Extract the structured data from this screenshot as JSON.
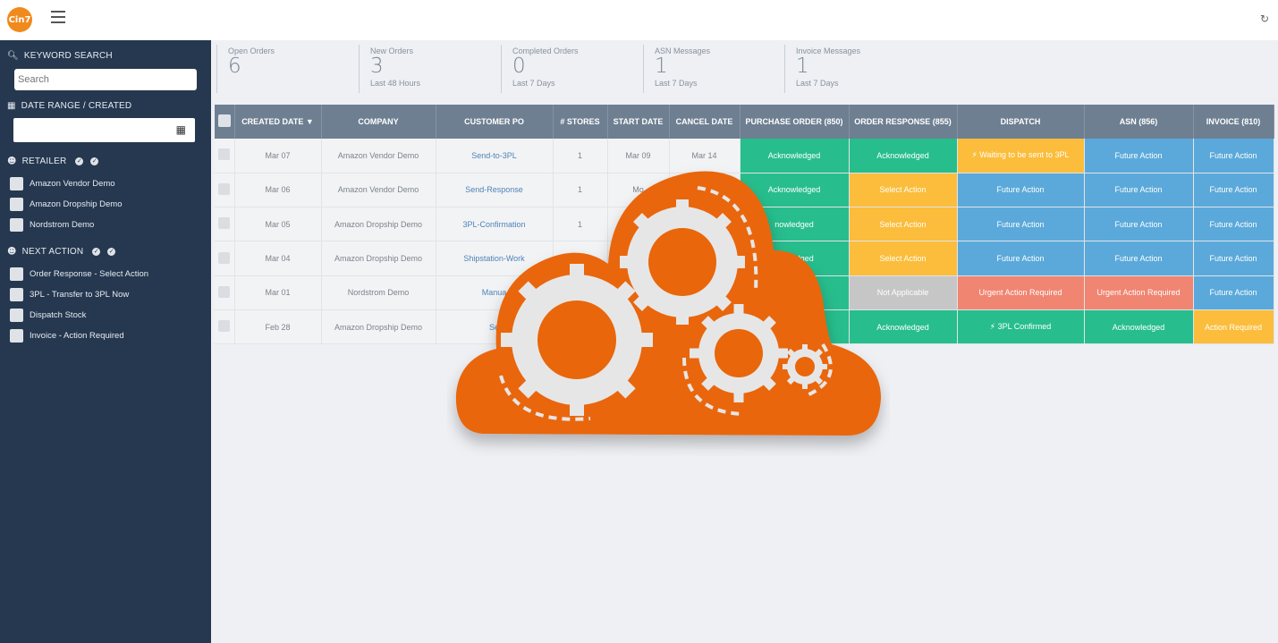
{
  "app": {
    "logo_text": "Cin7"
  },
  "icons": {
    "menu": "hamburger-icon",
    "refresh": "refresh-icon",
    "search": "search-icon",
    "calendar": "calendar-icon",
    "users": "users-icon",
    "check": "check-circle-icon",
    "bolt": "bolt-icon"
  },
  "sidebar": {
    "keyword_search": {
      "label": "KEYWORD SEARCH",
      "placeholder": "Search"
    },
    "date_range": {
      "label": "DATE RANGE / CREATED"
    },
    "retailer": {
      "label": "RETAILER",
      "items": [
        "Amazon Vendor Demo",
        "Amazon Dropship Demo",
        "Nordstrom Demo"
      ]
    },
    "next_action": {
      "label": "NEXT ACTION",
      "items": [
        "Order Response - Select Action",
        "3PL - Transfer to 3PL Now",
        "Dispatch Stock",
        "Invoice - Action Required"
      ]
    }
  },
  "stats": [
    {
      "label": "Open Orders",
      "value": "6",
      "sub": ""
    },
    {
      "label": "New Orders",
      "value": "3",
      "sub": "Last 48 Hours"
    },
    {
      "label": "Completed Orders",
      "value": "0",
      "sub": "Last 7 Days"
    },
    {
      "label": "ASN Messages",
      "value": "1",
      "sub": "Last 7 Days"
    },
    {
      "label": "Invoice Messages",
      "value": "1",
      "sub": "Last 7 Days"
    }
  ],
  "table": {
    "headers": [
      "CREATED DATE",
      "COMPANY",
      "CUSTOMER PO",
      "# STORES",
      "START DATE",
      "CANCEL DATE",
      "PURCHASE ORDER (850)",
      "ORDER RESPONSE (855)",
      "DISPATCH",
      "ASN (856)",
      "INVOICE (810)"
    ],
    "sort_indicator": "▼",
    "rows": [
      {
        "created": "Mar 07",
        "company": "Amazon Vendor Demo",
        "po": "Send-to-3PL",
        "stores": "1",
        "start": "Mar 09",
        "cancel": "Mar 14",
        "po850": "Acknowledged",
        "resp855": "Acknowledged",
        "dispatch": "Waiting to be sent to 3PL",
        "asn": "Future Action",
        "invoice": "Future Action"
      },
      {
        "created": "Mar 06",
        "company": "Amazon Vendor Demo",
        "po": "Send-Response",
        "stores": "1",
        "start": "Mo",
        "cancel": "",
        "po850": "Acknowledged",
        "resp855": "Select Action",
        "dispatch": "Future Action",
        "asn": "Future Action",
        "invoice": "Future Action"
      },
      {
        "created": "Mar 05",
        "company": "Amazon Dropship Demo",
        "po": "3PL-Confirmation",
        "stores": "1",
        "start": "",
        "cancel": "",
        "po850": "nowledged",
        "resp855": "Select Action",
        "dispatch": "Future Action",
        "asn": "Future Action",
        "invoice": "Future Action"
      },
      {
        "created": "Mar 04",
        "company": "Amazon Dropship Demo",
        "po": "Shipstation-Work",
        "stores": "",
        "start": "",
        "cancel": "",
        "po850": "nowledged",
        "resp855": "Select Action",
        "dispatch": "Future Action",
        "asn": "Future Action",
        "invoice": "Future Action"
      },
      {
        "created": "Mar 01",
        "company": "Nordstrom Demo",
        "po": "Manua",
        "stores": "",
        "start": "",
        "cancel": "",
        "po850": "",
        "resp855": "Not Applicable",
        "dispatch": "Urgent Action Required",
        "asn": "Urgent Action Required",
        "invoice": "Future Action"
      },
      {
        "created": "Feb 28",
        "company": "Amazon Dropship Demo",
        "po": "Se",
        "stores": "",
        "start": "",
        "cancel": "",
        "po850": "",
        "resp855": "Acknowledged",
        "dispatch": "3PL Confirmed",
        "asn": "Acknowledged",
        "invoice": "Action Required"
      }
    ]
  },
  "colors": {
    "sidebar_bg": "#263850",
    "header_bg": "#6e7f92",
    "green": "#27bd8c",
    "yellow": "#fbbd3b",
    "blue": "#5ba9da",
    "grey": "#c6c6c6",
    "red": "#f08572",
    "cloud": "#e9660a"
  }
}
